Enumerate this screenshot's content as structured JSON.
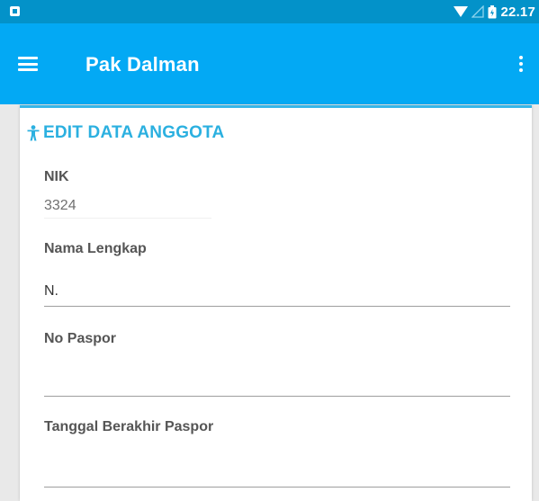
{
  "status_bar": {
    "time": "22.17",
    "icons": [
      "app-notification-icon",
      "wifi-icon",
      "signal-icon",
      "battery-icon"
    ]
  },
  "app_bar": {
    "title": "Pak Dalman",
    "menu_icon": "hamburger-menu-icon",
    "overflow_icon": "overflow-menu-icon"
  },
  "form": {
    "section_title": "EDIT DATA ANGGOTA",
    "section_icon": "person-icon",
    "fields": [
      {
        "label": "NIK",
        "value": "3324"
      },
      {
        "label": "Nama Lengkap",
        "value": "N."
      },
      {
        "label": "No Paspor",
        "value": ""
      },
      {
        "label": "Tanggal Berakhir Paspor",
        "value": ""
      }
    ]
  },
  "colors": {
    "status_bar": "#0392c9",
    "app_bar": "#03a9f4",
    "accent": "#2bb0e0"
  }
}
